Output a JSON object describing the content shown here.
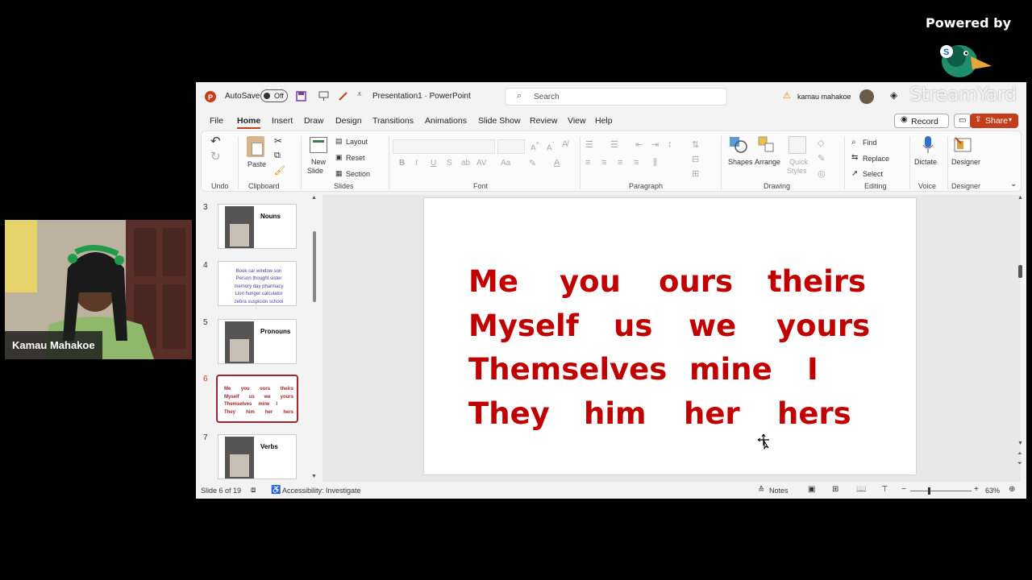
{
  "branding": {
    "powered_by": "Powered by",
    "watermark": "StreamYard"
  },
  "webcam": {
    "name": "Kamau Mahakoe"
  },
  "titlebar": {
    "autosave_label": "AutoSave",
    "autosave_state": "Off",
    "doc_title": "Presentation1 · PowerPoint",
    "search_placeholder": "Search",
    "user_name": "kamau mahakoe"
  },
  "menu": {
    "tabs": [
      "File",
      "Home",
      "Insert",
      "Draw",
      "Design",
      "Transitions",
      "Animations",
      "Slide Show",
      "Review",
      "View",
      "Help"
    ],
    "active_tab": "Home",
    "record_label": "Record",
    "share_label": "Share"
  },
  "ribbon": {
    "undo_group": "Undo",
    "clipboard": {
      "paste": "Paste",
      "group": "Clipboard"
    },
    "slides": {
      "new_slide_1": "New",
      "new_slide_2": "Slide",
      "layout": "Layout",
      "reset": "Reset",
      "section": "Section",
      "group": "Slides"
    },
    "font": {
      "group": "Font",
      "bold": "B",
      "italic": "I",
      "underline": "U",
      "strike": "S"
    },
    "paragraph": {
      "group": "Paragraph"
    },
    "drawing": {
      "shapes": "Shapes",
      "arrange": "Arrange",
      "quick_styles_1": "Quick",
      "quick_styles_2": "Styles",
      "group": "Drawing"
    },
    "editing": {
      "find": "Find",
      "replace": "Replace",
      "select": "Select",
      "group": "Editing"
    },
    "voice": {
      "dictate": "Dictate",
      "group": "Voice"
    },
    "designer": {
      "label": "Designer",
      "group": "Designer"
    }
  },
  "thumbnails": [
    {
      "num": "3",
      "title": "Nouns"
    },
    {
      "num": "4",
      "rows": [
        "Book  car  window  son",
        "Person  thought  sister",
        "memory  day  pharmacy",
        "Lion  hunger  calculator",
        "zebra  suspicion  school"
      ]
    },
    {
      "num": "5",
      "title": "Pronouns"
    },
    {
      "num": "6",
      "rows": [
        [
          "Me",
          "you",
          "ours",
          "theirs"
        ],
        [
          "Myself",
          "us",
          "we",
          "yours"
        ],
        [
          "Themselves",
          "mine",
          "I"
        ],
        [
          "They",
          "him",
          "her",
          "hers"
        ]
      ]
    },
    {
      "num": "7",
      "title": "Verbs"
    }
  ],
  "slide": {
    "rows": [
      [
        "Me",
        "you",
        "ours",
        "theirs"
      ],
      [
        "Myself",
        "us",
        "we",
        "yours"
      ],
      [
        "Themselves",
        "mine",
        "I"
      ],
      [
        "They",
        "him",
        "her",
        "hers"
      ]
    ]
  },
  "status": {
    "slide_pos": "Slide 6 of 19",
    "accessibility": "Accessibility: Investigate",
    "notes": "Notes",
    "zoom": "63%"
  },
  "colors": {
    "accent": "#c43e1c",
    "slide_text": "#c00000",
    "active_thumb": "#a1262c"
  }
}
